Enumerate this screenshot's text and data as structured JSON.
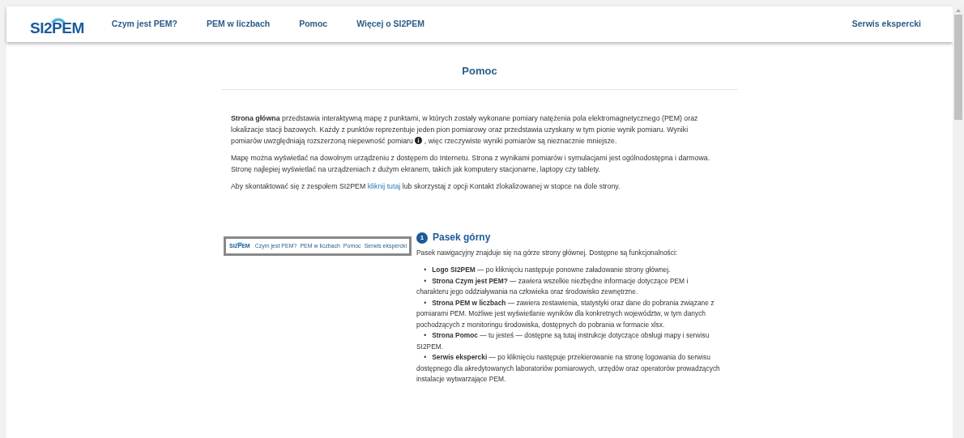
{
  "nav": {
    "logo": "SI2PEM",
    "links": [
      {
        "label": "Czym jest PEM?"
      },
      {
        "label": "PEM w liczbach"
      },
      {
        "label": "Pomoc"
      },
      {
        "label": "Więcej o SI2PEM"
      }
    ],
    "right_link": "Serwis ekspercki"
  },
  "page_title": "Pomoc",
  "intro": {
    "p1_before": "**Strona główna** przedstawia interaktywną mapę z punktami, w których zostały wykonane pomiary natężenia pola elektromagnetycznego (PEM) oraz lokalizacje stacji bazowych. Każdy z punktów reprezentuje jeden pion pomiarowy oraz przedstawia uzyskany w tym pionie wynik pomiaru. Wyniki pomiarów uwzględniają rozszerzoną niepewność pomiaru",
    "p1_after": ", więc rzeczywiste wyniki pomiarów są nieznacznie mniejsze.",
    "p2": "Mapę można wyświetlać na dowolnym urządzeniu z dostępem do Internetu. Strona z wynikami pomiarów i symulacjami jest ogólnodostępna i darmowa. Stronę najlepiej wyświetlać na urządzeniach z dużym ekranem, takich jak komputery stacjonarne, laptopy czy tablety.",
    "p3_before": "Aby skontaktować się z zespołem SI2PEM",
    "p3_link": "kliknij tutaj",
    "p3_after": "lub skorzystaj z opcji Kontakt zlokalizowanej w stopce na dole strony."
  },
  "section": {
    "number": "1",
    "title": "Pasek górny",
    "thumbnail": {
      "logo": "SI2PEM",
      "links": [
        "Czym jest PEM?",
        "PEM w liczbach",
        "Pomoc"
      ],
      "right_link": "Serwis ekspercki"
    },
    "lead": "Pasek nawigacyjny znajduje się na górze strony głównej. Dostępne są funkcjonalności:",
    "items": [
      {
        "bullet": "•",
        "text": "**Logo SI2PEM** — po kliknięciu następuje ponowne załadowanie strony głównej."
      },
      {
        "bullet": "•",
        "text": "**Strona Czym jest PEM?** — zawiera wszelkie niezbędne informacje dotyczące PEM i charakteru jego oddziaływania na człowieka oraz środowisko zewnętrzne."
      },
      {
        "bullet": "•",
        "text": "**Strona PEM w liczbach** — zawiera zestawienia, statystyki oraz dane do pobrania związane z pomiarami PEM. Możliwe jest wyświetlanie wyników dla konkretnych województw, w tym danych pochodzących z monitoringu środowiska, dostępnych do pobrania w formacie xlsx."
      },
      {
        "bullet": "•",
        "text": "**Strona Pomoc** — tu jesteś — dostępne są tutaj instrukcje dotyczące obsługi mapy i serwisu SI2PEM."
      },
      {
        "bullet": "•",
        "text": "**Serwis ekspercki** — po kliknięciu następuje przekierowanie na stronę logowania do serwisu dostępnego dla akredytowanych laboratoriów pomiarowych, urzędów oraz operatorów prowadzących instalacje wytwarzające PEM."
      }
    ]
  }
}
